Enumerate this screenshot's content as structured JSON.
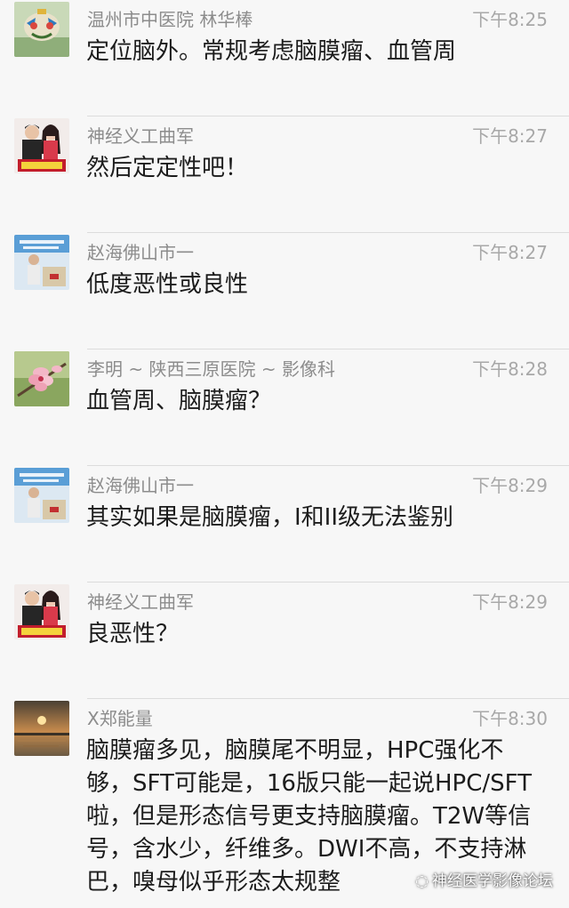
{
  "messages": [
    {
      "name": "温州市中医院 林华棒",
      "time": "下午8:25",
      "text": "定位脑外。常规考虑脑膜瘤、血管周",
      "avatar": "avatar-mask-icon"
    },
    {
      "name": "神经义工曲军",
      "time": "下午8:27",
      "text": "然后定定性吧！",
      "avatar": "avatar-couple-icon"
    },
    {
      "name": "赵海佛山市一",
      "time": "下午8:27",
      "text": "低度恶性或良性",
      "avatar": "avatar-lecturer-icon"
    },
    {
      "name": "李明 ~ 陕西三原医院 ~ 影像科",
      "time": "下午8:28",
      "text": "血管周、脑膜瘤？",
      "avatar": "avatar-flower-icon"
    },
    {
      "name": "赵海佛山市一",
      "time": "下午8:29",
      "text": "其实如果是脑膜瘤，I和II级无法鉴别",
      "avatar": "avatar-lecturer-icon"
    },
    {
      "name": "神经义工曲军",
      "time": "下午8:29",
      "text": "良恶性？",
      "avatar": "avatar-couple-icon"
    },
    {
      "name": "X郑能量",
      "time": "下午8:30",
      "text": "脑膜瘤多见，脑膜尾不明显，HPC强化不够，SFT可能是，16版只能一起说HPC/SFT啦，但是形态信号更支持脑膜瘤。T2W等信号，含水少，纤维多。DWI不高，不支持淋巴，嗅母似乎形态太规整",
      "avatar": "avatar-sunset-icon"
    }
  ],
  "watermark": "神经医学影像论坛",
  "colors": {
    "background": "#f7f7f7",
    "name": "#8c8c8c",
    "time": "#a8a8a8",
    "text": "#1c1c1c"
  }
}
